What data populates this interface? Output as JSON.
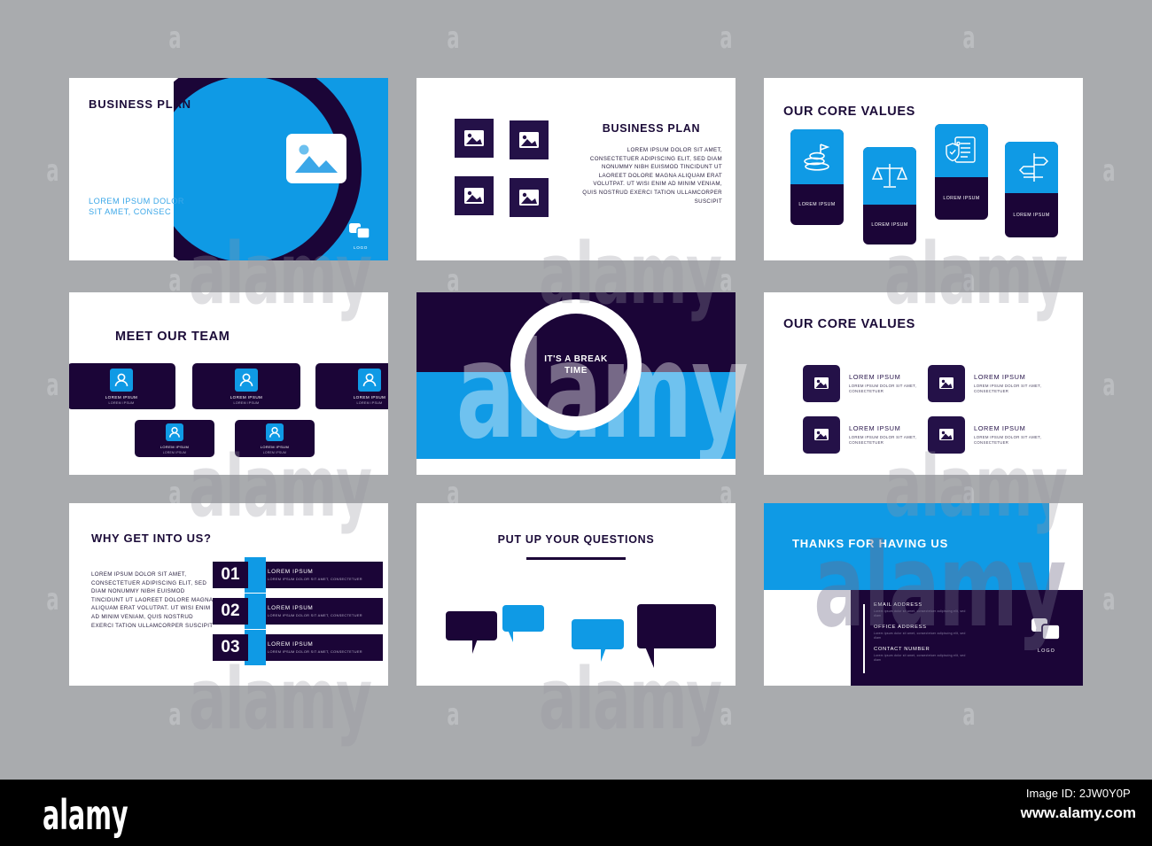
{
  "palette": {
    "blue": "#0f9ae5",
    "navy": "#1b0537",
    "navy_soft": "#241148",
    "background": "#a9abae",
    "white": "#ffffff"
  },
  "watermark": {
    "letter": "a",
    "word": "alamy",
    "brand": "alamy",
    "image_id": "Image ID: 2JW0Y0P",
    "url": "www.alamy.com"
  },
  "slides": [
    {
      "id": "title-slide",
      "title": "BUSINESS PLAN",
      "subtitle_line1": "LOREM IPSUM DOLOR",
      "subtitle_line2": "SIT AMET, CONSEC",
      "logo_label": "LOGO",
      "image_placeholder": "image-placeholder-icon"
    },
    {
      "id": "business-plan-gallery",
      "title": "BUSINESS PLAN",
      "body": "LOREM IPSUM DOLOR SIT AMET, CONSECTETUER ADIPISCING ELIT, SED DIAM NONUMMY NIBH EUISMOD TINCIDUNT UT LAOREET DOLORE MAGNA ALIQUAM ERAT VOLUTPAT. UT WISI ENIM AD MINIM VENIAM, QUIS NOSTRUD EXERCI TATION ULLAMCORPER SUSCIPIT",
      "thumbs": [
        "image-placeholder-icon",
        "image-placeholder-icon",
        "image-placeholder-icon",
        "image-placeholder-icon"
      ]
    },
    {
      "id": "core-values-cards",
      "title": "OUR CORE VALUES",
      "cards": [
        {
          "label": "LOREM IPSUM",
          "icon": "mountain-flag-icon"
        },
        {
          "label": "LOREM IPSUM",
          "icon": "scales-balance-icon"
        },
        {
          "label": "LOREM IPSUM",
          "icon": "shield-document-icon"
        },
        {
          "label": "LOREM IPSUM",
          "icon": "signpost-icon"
        }
      ]
    },
    {
      "id": "meet-our-team",
      "title": "MEET OUR TEAM",
      "members": [
        {
          "name": "LOREM IPSUM",
          "role": "LOREM IPSUM"
        },
        {
          "name": "LOREM IPSUM",
          "role": "LOREM IPSUM"
        },
        {
          "name": "LOREM IPSUM",
          "role": "LOREM IPSUM"
        },
        {
          "name": "LOREM IPSUM",
          "role": "LOREM IPSUM"
        },
        {
          "name": "LOREM IPSUM",
          "role": "LOREM IPSUM"
        }
      ]
    },
    {
      "id": "break-time",
      "line1": "IT'S A BREAK",
      "line2": "TIME"
    },
    {
      "id": "core-values-list",
      "title": "OUR CORE VALUES",
      "items": [
        {
          "heading": "LOREM IPSUM",
          "text": "LOREM IPSUM DOLOR SIT AMET, CONSECTETUER",
          "icon": "image-placeholder-icon"
        },
        {
          "heading": "LOREM IPSUM",
          "text": "LOREM IPSUM DOLOR SIT AMET, CONSECTETUER",
          "icon": "image-placeholder-icon"
        },
        {
          "heading": "LOREM IPSUM",
          "text": "LOREM IPSUM DOLOR SIT AMET, CONSECTETUER",
          "icon": "image-placeholder-icon"
        },
        {
          "heading": "LOREM IPSUM",
          "text": "LOREM IPSUM DOLOR SIT AMET, CONSECTETUER",
          "icon": "image-placeholder-icon"
        }
      ]
    },
    {
      "id": "why-get-into-us",
      "title": "WHY GET INTO US?",
      "body": "LOREM IPSUM DOLOR SIT AMET, CONSECTETUER ADIPISCING ELIT, SED DIAM NONUMMY NIBH EUISMOD TINCIDUNT UT LAOREET DOLORE MAGNA ALIQUAM ERAT VOLUTPAT. UT WISI ENIM AD MINIM VENIAM, QUIS NOSTRUD EXERCI TATION ULLAMCORPER SUSCIPIT",
      "steps": [
        {
          "number": "01",
          "heading": "LOREM IPSUM",
          "text": "LOREM IPSUM DOLOR SIT AMET, CONSECTETUER"
        },
        {
          "number": "02",
          "heading": "LOREM IPSUM",
          "text": "LOREM IPSUM DOLOR SIT AMET, CONSECTETUER"
        },
        {
          "number": "03",
          "heading": "LOREM IPSUM",
          "text": "LOREM IPSUM DOLOR SIT AMET, CONSECTETUER"
        }
      ]
    },
    {
      "id": "questions",
      "title": "PUT UP YOUR QUESTIONS",
      "bubbles": [
        "navy",
        "blue",
        "blue",
        "navy"
      ]
    },
    {
      "id": "thanks",
      "title": "THANKS FOR HAVING US",
      "logo_label": "LOGO",
      "contacts": [
        {
          "heading": "EMAIL ADDRESS",
          "text": "Lorem ipsum dolor sit amet, consectetuer adipiscing elit, sed diam"
        },
        {
          "heading": "OFFICE ADDRESS",
          "text": "Lorem ipsum dolor sit amet, consectetuer adipiscing elit, sed diam"
        },
        {
          "heading": "CONTACT NUMBER",
          "text": "Lorem ipsum dolor sit amet, consectetuer adipiscing elit, sed diam"
        }
      ]
    }
  ]
}
